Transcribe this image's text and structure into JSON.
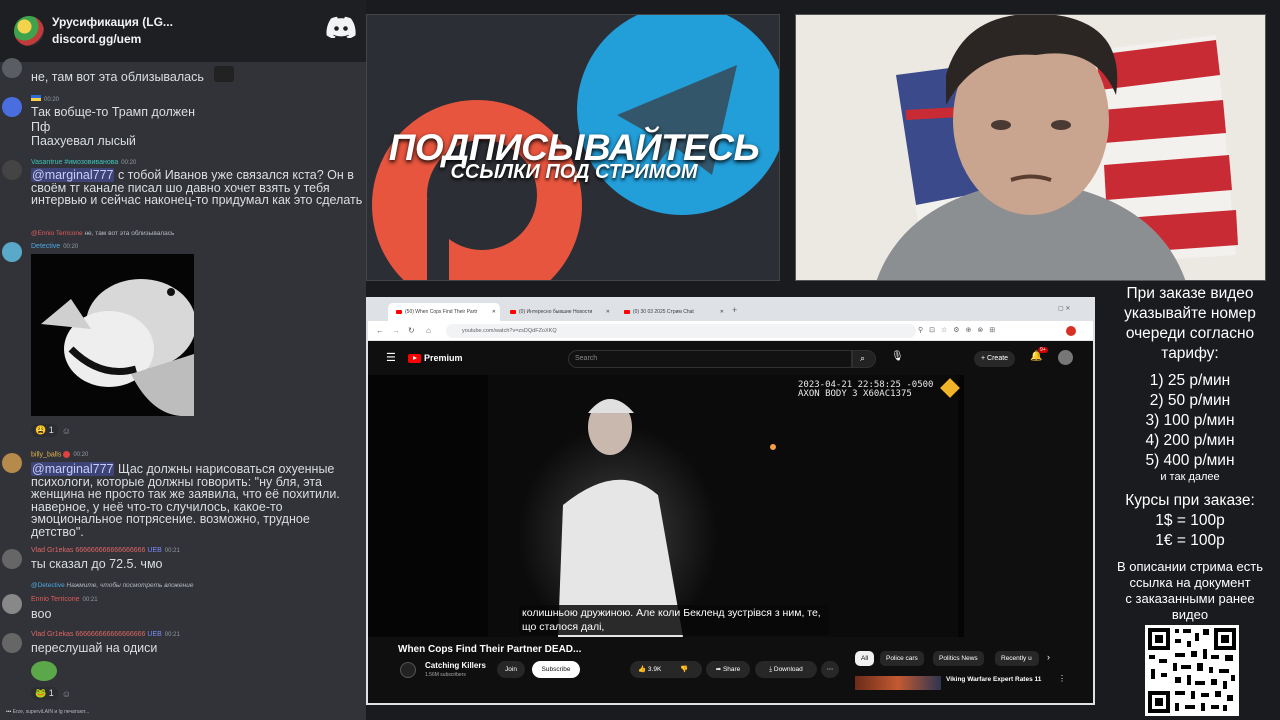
{
  "chat": {
    "server_name": "Урусификация (LG...",
    "server_invite": "discord.gg/uem",
    "messages": [
      {
        "text": "не, там вот эта облизывалась"
      },
      {
        "author": "",
        "time": "00:20",
        "lines": [
          "Так вобще-то Трамп должен",
          "Пф",
          "Паахуевал лысый"
        ]
      },
      {
        "author": "Vasantrue",
        "author_tag": "#имозовиванова",
        "time": "00:20",
        "mention": "@marginal777",
        "text": " с тобой Иванов уже связался кста? Он в своём тг канале писал шо давно хочет взять у тебя интервью и сейчас наконец-то придумал как это сделать"
      },
      {
        "reply_author": "@Ennio Terricone",
        "reply_text": "не, там вот эта облизывалась",
        "author": "Detective",
        "time": "00:20"
      },
      {
        "reaction_count": "1"
      },
      {
        "author": "billy_balls",
        "time": "00:20",
        "mention": "@marginal777",
        "text": " Щас должны нарисоваться охуенные психологи, которые должны говорить: \"ну бля, эта женщина не просто так же заявила, что её похитили. наверное, у неё что-то случилось, какое-то эмоциональное потрясение. возможно, трудное детство\"."
      },
      {
        "author": "Vlad Gr",
        "author_suffix": "1ekas 666666666666666666",
        "badge": "UEB",
        "time": "00:21",
        "text": "ты сказал до 72.5. чмо"
      },
      {
        "reply_author": "@Detective",
        "reply_text": "Нажмите, чтобы посмотреть вложение",
        "author": "Ennio Terricone",
        "time": "00:21",
        "text": "воо"
      },
      {
        "author": "Vlad Gr",
        "author_suffix": "1ekas 666666666666666666",
        "badge": "UEB",
        "time": "00:21",
        "text": "переслушай на одиси"
      },
      {
        "reaction_count": "1"
      }
    ],
    "typing": "Erze, superviLAIN и Ig печатают..."
  },
  "promo": {
    "line1": "ПОДПИСЫВАЙТЕСЬ",
    "line2": "ССЫЛКИ ПОД СТРИМОМ"
  },
  "browser": {
    "tabs": [
      "(50) When Cops Find Their Partr",
      "(0) Интересно бывшие Новости",
      "(0) 30 03 2025 Стрим Chat"
    ],
    "url": "youtube.com/watch?v=zsDQdFZoXKQ",
    "yt": {
      "logo_label": "Premium",
      "search_placeholder": "Search",
      "create_label": "Create",
      "notif_count": "9+",
      "bodycam_overlay": "2023-04-21 22:58:25 -0500\nAXON BODY 3 X60AC1375",
      "subtitle": "колишньою дружиною.  Але коли Бекленд зустрівся з ним, те, що сталося далі,",
      "video_title": "When Cops Find Their Partner DEAD...",
      "channel_name": "Catching Killers",
      "channel_subs": "1.56M subscribers",
      "join_label": "Join",
      "subscribe_label": "Subscribe",
      "likes": "3.9K",
      "share_label": "Share",
      "download_label": "Download",
      "chips": [
        "All",
        "Police cars",
        "Politics News",
        "Recently u"
      ],
      "related_title": "Viking Warfare Expert Rates 11"
    }
  },
  "info": {
    "intro": [
      "При заказе видео",
      "указывайте номер",
      "очереди согласно",
      "тарифу:"
    ],
    "tariffs": [
      "1) 25 р/мин",
      "2) 50 р/мин",
      "3) 100 р/мин",
      "4) 200 р/мин",
      "5) 400 р/мин"
    ],
    "tariffs_more": "и так далее",
    "rates_title": "Курсы при заказе:",
    "rates": [
      "1$ = 100р",
      "1€ = 100р"
    ],
    "outro": [
      "В описании стрима есть",
      "ссылка на документ",
      "с заказанными ранее",
      "видео"
    ]
  },
  "colors": {
    "discord_bg": "#313338",
    "mention_bg": "#5865f2",
    "youtube_red": "#ff0000",
    "telegram_blue": "#229ed9",
    "patreon_orange": "#e8553e"
  }
}
